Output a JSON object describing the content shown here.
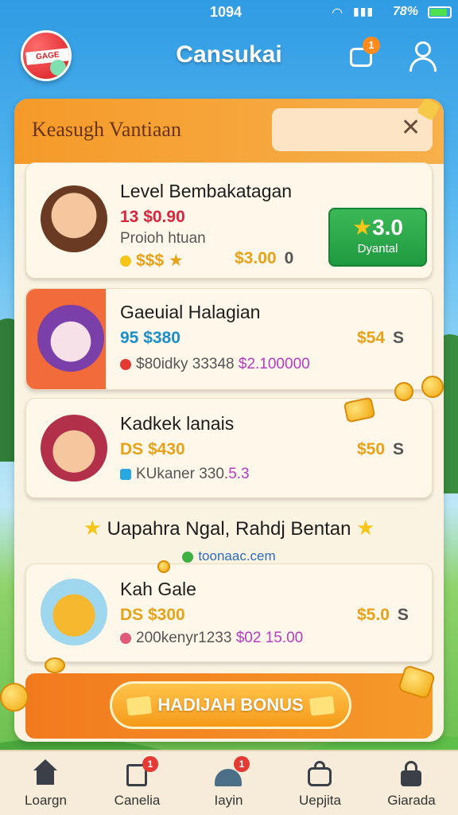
{
  "status_bar": {
    "time": "1094",
    "battery_text": "78%"
  },
  "header": {
    "app_title": "Cansukai",
    "logo_text": "GAGE",
    "message_badge": "1"
  },
  "panel": {
    "title": "Keasugh Vantiaan"
  },
  "cards": [
    {
      "title": "Level Bembakatagan",
      "price": "13 $0.90",
      "subtitle": "Proioh htuan",
      "stars": "$$$",
      "side_value": "$3.00",
      "side_suffix": "0",
      "claim_value": "3.0",
      "claim_label": "Dyantal"
    },
    {
      "title": "Gaeuial Halagian",
      "price": "95 $380",
      "sub": "$80idky 33348",
      "sub_highlight": "$2.100000",
      "side_value": "$54",
      "side_suffix": "S"
    },
    {
      "title": "Kadkek lanais",
      "price": "DS $430",
      "sub": "KUkaner 330.",
      "sub_highlight": "5.3",
      "side_value": "$50",
      "side_suffix": "S"
    },
    {
      "title": "Kah Gale",
      "price": "DS $300",
      "sub": "200kenyr1233",
      "sub_highlight": "$02 15.00",
      "side_value": "$5.0",
      "side_suffix": "S"
    }
  ],
  "promo": {
    "title": "Uapahra Ngal, Rahdj Bentan",
    "link": "toonaac.cem"
  },
  "bonus_button": {
    "label": "HADIJAH BONUS"
  },
  "bottom_nav": [
    {
      "label": "Loargn",
      "icon": "home-icon",
      "badge": ""
    },
    {
      "label": "Canelia",
      "icon": "document-icon",
      "badge": "1"
    },
    {
      "label": "Iayin",
      "icon": "helmet-icon",
      "badge": "1"
    },
    {
      "label": "Uepjita",
      "icon": "bag-icon",
      "badge": ""
    },
    {
      "label": "Giarada",
      "icon": "lock-icon",
      "badge": ""
    }
  ],
  "colors": {
    "accent_orange": "#f59a2a",
    "claim_green": "#1f9a40",
    "gold": "#e7a21a",
    "price_red": "#d7263d"
  }
}
